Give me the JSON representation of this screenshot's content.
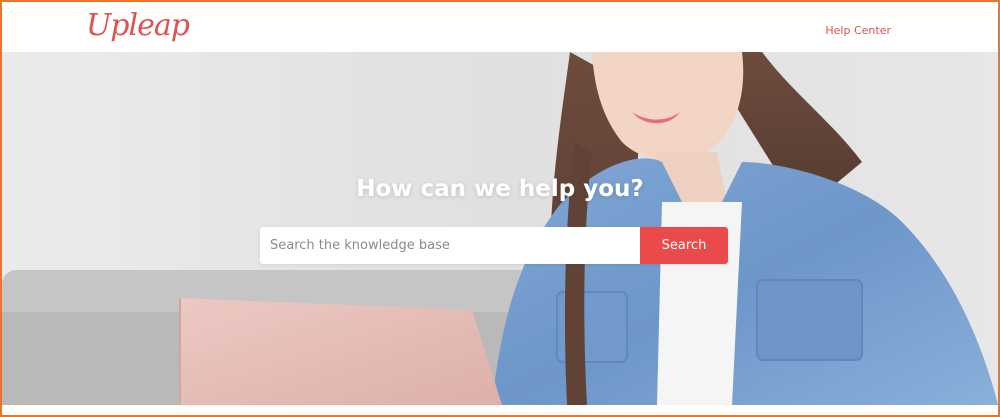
{
  "header": {
    "logo_text": "Upleap",
    "help_center_label": "Help Center"
  },
  "hero": {
    "title": "How can we help you?",
    "search": {
      "placeholder": "Search the knowledge base",
      "value": "",
      "button_label": "Search"
    }
  },
  "colors": {
    "brand": "#de5250",
    "button": "#ea4a4a",
    "frame_border": "#e8762b"
  }
}
